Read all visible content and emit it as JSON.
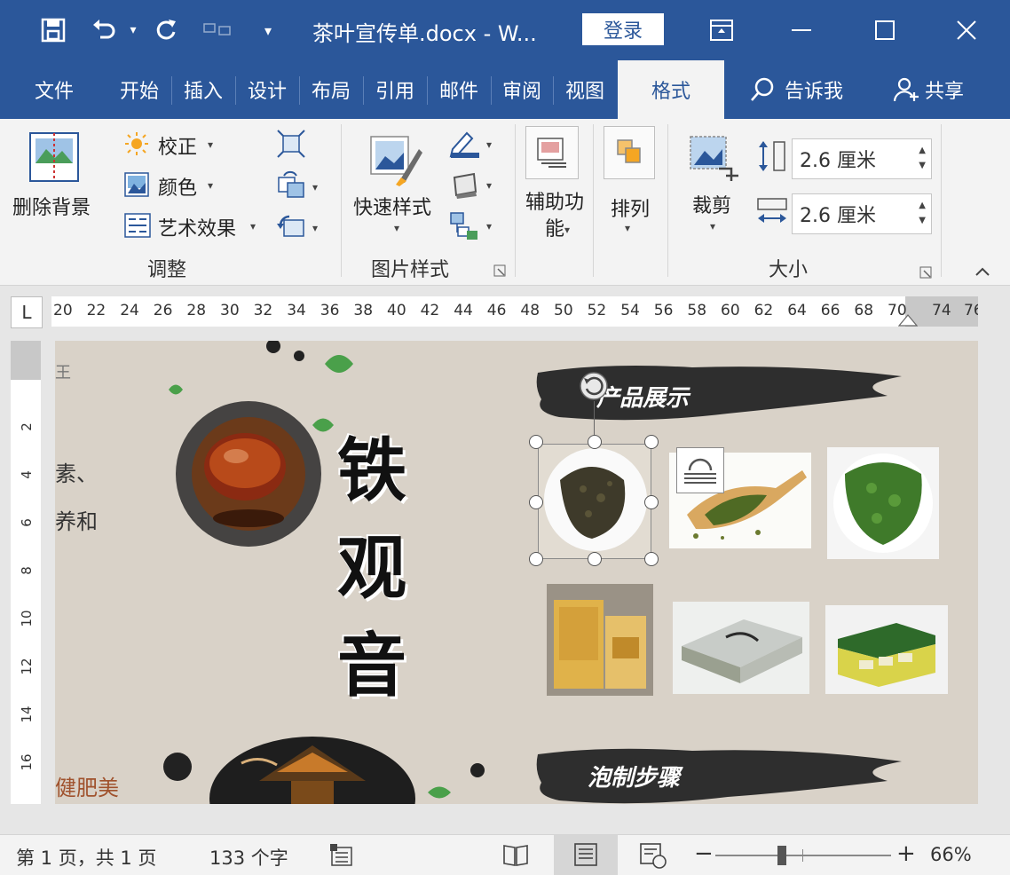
{
  "window": {
    "title": "茶叶宣传单.docx  -  W...",
    "login_label": "登录"
  },
  "tabs": [
    {
      "label": "文件"
    },
    {
      "label": "开始"
    },
    {
      "label": "插入"
    },
    {
      "label": "设计"
    },
    {
      "label": "布局"
    },
    {
      "label": "引用"
    },
    {
      "label": "邮件"
    },
    {
      "label": "审阅"
    },
    {
      "label": "视图"
    },
    {
      "label": "格式"
    }
  ],
  "tell_me": "告诉我",
  "share": "共享",
  "ribbon": {
    "adjust": {
      "remove_bg": "删除背景",
      "correct": "校正",
      "color": "颜色",
      "art_effect": "艺术效果",
      "group_label": "调整"
    },
    "picture_styles": {
      "quick_styles": "快速样式",
      "group_label": "图片样式"
    },
    "accessibility": "辅助功能",
    "arrange": "排列",
    "size": {
      "crop": "裁剪",
      "height_value": "2.6 厘米",
      "width_value": "2.6 厘米",
      "group_label": "大小"
    }
  },
  "ruler": {
    "corner": "L",
    "ticks": [
      "20",
      "22",
      "24",
      "26",
      "28",
      "30",
      "32",
      "34",
      "36",
      "38",
      "40",
      "42",
      "44",
      "46",
      "48",
      "50",
      "52",
      "54",
      "56",
      "58",
      "60",
      "62",
      "64",
      "66",
      "68",
      "70",
      "74",
      "76"
    ],
    "vticks": [
      "2",
      "4",
      "6",
      "8",
      "10",
      "12",
      "14",
      "16"
    ]
  },
  "document": {
    "left_fragments": [
      "王",
      "素、",
      "养和",
      "健肥美"
    ],
    "title_chars": [
      "铁",
      "观",
      "音"
    ],
    "banner_products": "产品展示",
    "banner_steps": "泡制步骤"
  },
  "status": {
    "page_info": "第 1 页，共 1 页",
    "word_count": "133 个字",
    "zoom_minus": "−",
    "zoom_plus": "+",
    "zoom_level": "66%",
    "zoom_fraction": 0.38
  },
  "colors": {
    "brand": "#2b579a",
    "ribbon_bg": "#f3f3f3",
    "doc_bg": "#d9d2c8"
  }
}
